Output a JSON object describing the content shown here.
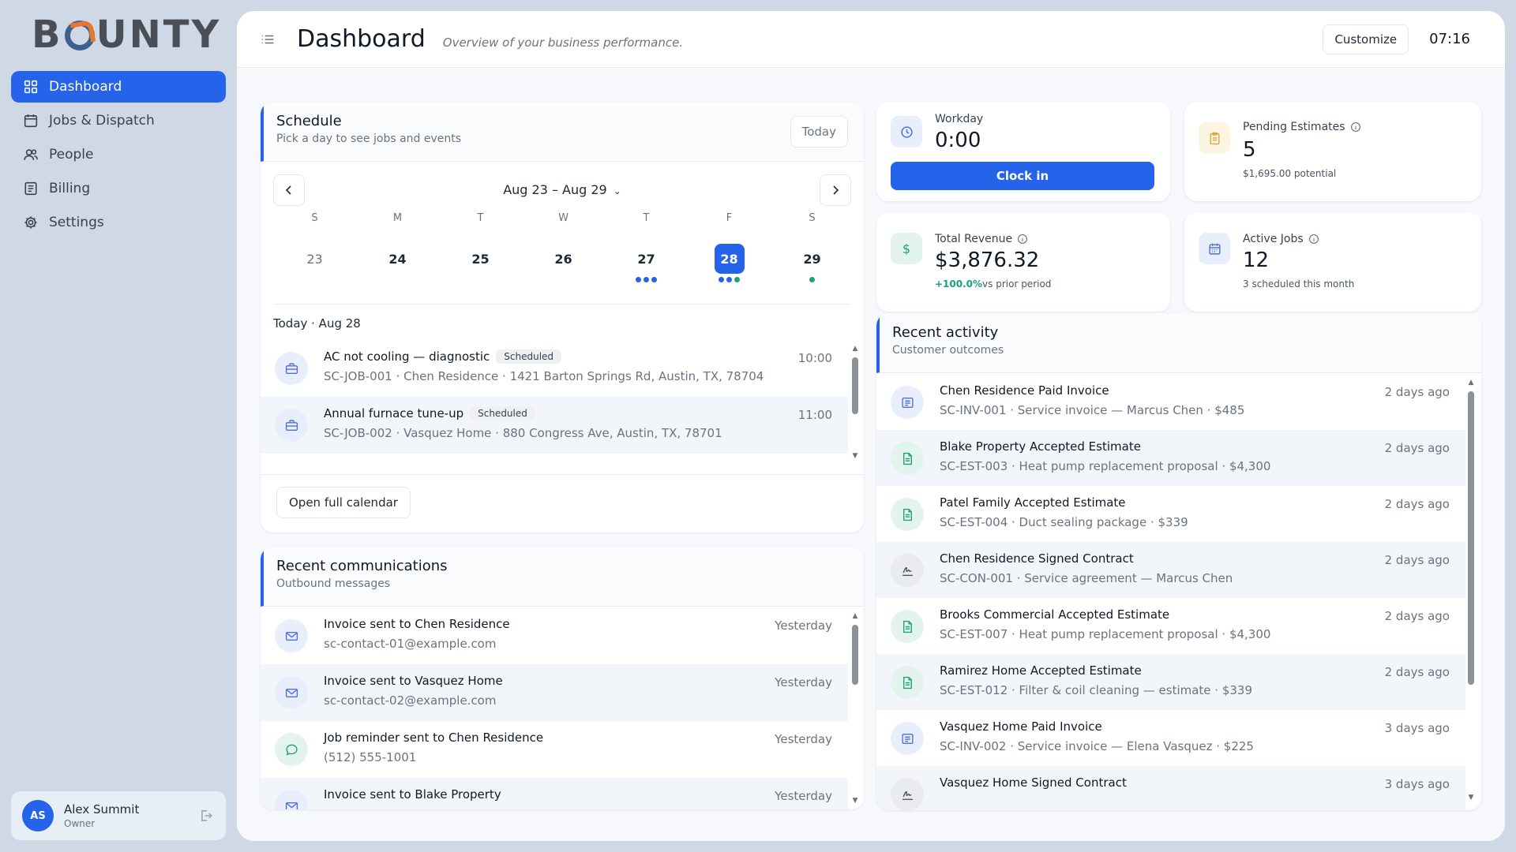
{
  "brand": {
    "logo_text_1": "B",
    "logo_text_2": "UNTY"
  },
  "sidebar": {
    "items": [
      {
        "label": "Dashboard",
        "icon": "grid-icon"
      },
      {
        "label": "Jobs & Dispatch",
        "icon": "calendar-icon"
      },
      {
        "label": "People",
        "icon": "people-icon"
      },
      {
        "label": "Billing",
        "icon": "receipt-icon"
      },
      {
        "label": "Settings",
        "icon": "gear-icon"
      }
    ],
    "user": {
      "initials": "AS",
      "name": "Alex Summit",
      "role": "Owner"
    }
  },
  "header": {
    "title": "Dashboard",
    "subtitle": "Overview of your business performance.",
    "customize_label": "Customize",
    "clock": "07:16"
  },
  "schedule": {
    "title": "Schedule",
    "subtitle": "Pick a day to see jobs and events",
    "today_label": "Today",
    "week_label": "Aug 23 – Aug 29",
    "days": [
      {
        "letter": "S",
        "num": "23"
      },
      {
        "letter": "M",
        "num": "24"
      },
      {
        "letter": "T",
        "num": "25"
      },
      {
        "letter": "W",
        "num": "26"
      },
      {
        "letter": "T",
        "num": "27"
      },
      {
        "letter": "F",
        "num": "28"
      },
      {
        "letter": "S",
        "num": "29"
      }
    ],
    "day_label": "Today · Aug 28",
    "jobs": [
      {
        "title": "AC not cooling — diagnostic",
        "status": "Scheduled",
        "time": "10:00",
        "detail": "SC-JOB-001 · Chen Residence · 1421 Barton Springs Rd, Austin, TX, 78704"
      },
      {
        "title": "Annual furnace tune-up",
        "status": "Scheduled",
        "time": "11:00",
        "detail": "SC-JOB-002 · Vasquez Home · 880 Congress Ave, Austin, TX, 78701"
      }
    ],
    "open_calendar_label": "Open full calendar"
  },
  "communications": {
    "title": "Recent communications",
    "subtitle": "Outbound messages",
    "items": [
      {
        "title": "Invoice sent to Chen Residence",
        "detail": "sc-contact-01@example.com",
        "time": "Yesterday"
      },
      {
        "title": "Invoice sent to Vasquez Home",
        "detail": "sc-contact-02@example.com",
        "time": "Yesterday"
      },
      {
        "title": "Job reminder sent to Chen Residence",
        "detail": "(512) 555-1001",
        "time": "Yesterday"
      },
      {
        "title": "Invoice sent to Blake Property",
        "detail": "",
        "time": "Yesterday"
      }
    ]
  },
  "stats": {
    "workday": {
      "label": "Workday",
      "value": "0:00",
      "button": "Clock in"
    },
    "pending_estimates": {
      "label": "Pending Estimates",
      "value": "5",
      "note": "$1,695.00 potential"
    },
    "total_revenue": {
      "label": "Total Revenue",
      "value": "$3,876.32",
      "change": "+100.0%",
      "note": "vs prior period"
    },
    "active_jobs": {
      "label": "Active Jobs",
      "value": "12",
      "note": "3 scheduled this month"
    }
  },
  "activity": {
    "title": "Recent activity",
    "subtitle": "Customer outcomes",
    "items": [
      {
        "title": "Chen Residence Paid Invoice",
        "detail": "SC-INV-001 · Service invoice — Marcus Chen · $485",
        "time": "2 days ago"
      },
      {
        "title": "Blake Property Accepted Estimate",
        "detail": "SC-EST-003 · Heat pump replacement proposal · $4,300",
        "time": "2 days ago"
      },
      {
        "title": "Patel Family Accepted Estimate",
        "detail": "SC-EST-004 · Duct sealing package · $339",
        "time": "2 days ago"
      },
      {
        "title": "Chen Residence Signed Contract",
        "detail": "SC-CON-001 · Service agreement — Marcus Chen",
        "time": "2 days ago"
      },
      {
        "title": "Brooks Commercial Accepted Estimate",
        "detail": "SC-EST-007 · Heat pump replacement proposal · $4,300",
        "time": "2 days ago"
      },
      {
        "title": "Ramirez Home Accepted Estimate",
        "detail": "SC-EST-012 · Filter & coil cleaning — estimate · $339",
        "time": "2 days ago"
      },
      {
        "title": "Vasquez Home Paid Invoice",
        "detail": "SC-INV-002 · Service invoice — Elena Vasquez · $225",
        "time": "3 days ago"
      },
      {
        "title": "Vasquez Home Signed Contract",
        "detail": "",
        "time": "3 days ago"
      }
    ]
  },
  "colors": {
    "accent": "#2563eb",
    "positive": "#16a37f",
    "dot_green": "#22a07a"
  }
}
